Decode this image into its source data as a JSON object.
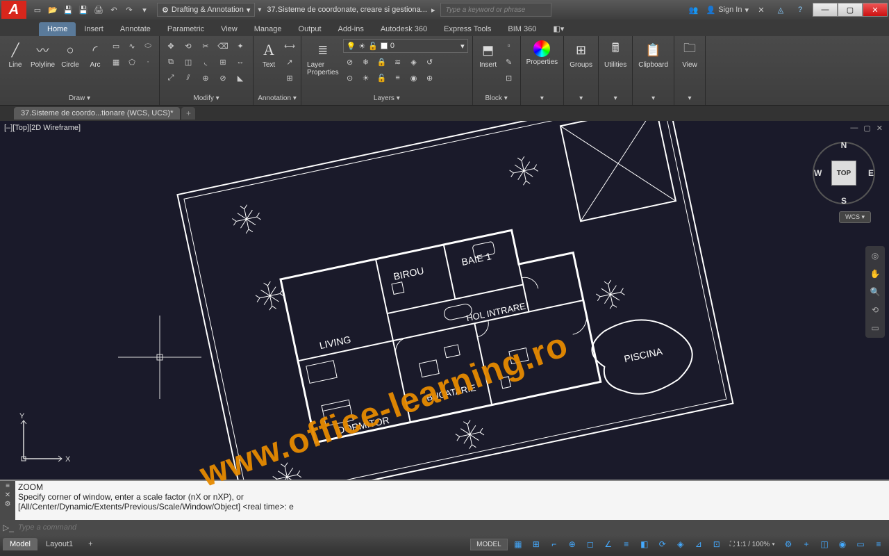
{
  "titlebar": {
    "workspace": "Drafting & Annotation",
    "document_title": "37.Sisteme de coordonate, creare si gestiona...",
    "search_placeholder": "Type a keyword or phrase",
    "signin": "Sign In"
  },
  "ribbon": {
    "tabs": [
      "Home",
      "Insert",
      "Annotate",
      "Parametric",
      "View",
      "Manage",
      "Output",
      "Add-ins",
      "Autodesk 360",
      "Express Tools",
      "BIM 360"
    ],
    "active_tab": "Home",
    "panels": {
      "draw": {
        "label": "Draw ▾",
        "line": "Line",
        "polyline": "Polyline",
        "circle": "Circle",
        "arc": "Arc"
      },
      "modify": {
        "label": "Modify ▾"
      },
      "annotation": {
        "label": "Annotation ▾",
        "text": "Text"
      },
      "layers": {
        "label": "Layers ▾",
        "props": "Layer\nProperties",
        "current": "0"
      },
      "block": {
        "label": "Block ▾",
        "insert": "Insert"
      },
      "properties": {
        "label": "Properties"
      },
      "groups": {
        "label": "Groups"
      },
      "utilities": {
        "label": "Utilities"
      },
      "clipboard": {
        "label": "Clipboard"
      },
      "view": {
        "label": "View"
      }
    }
  },
  "file_tab": "37.Sisteme de coordo...tionare (WCS, UCS)*",
  "viewport": {
    "label": "[–][Top][2D Wireframe]",
    "viewcube_face": "TOP",
    "wcs": "WCS",
    "ucs_x": "X",
    "ucs_y": "Y",
    "compass": {
      "n": "N",
      "s": "S",
      "e": "E",
      "w": "W"
    }
  },
  "rooms": {
    "birou": "BIROU",
    "baie1": "BAIE 1",
    "living": "LIVING",
    "hol": "HOL INTRARE",
    "dormitor": "DORMITOR",
    "bucatarie": "BUCATARIE",
    "piscina": "PISCINA"
  },
  "watermark": "www.office-learning.ro",
  "commandline": {
    "l1": "ZOOM",
    "l2": "Specify corner of window, enter a scale factor (nX or nXP), or",
    "l3": "[All/Center/Dynamic/Extents/Previous/Scale/Window/Object] <real time>: e",
    "placeholder": "Type a command"
  },
  "statusbar": {
    "model": "Model",
    "layout": "Layout1",
    "model_btn": "MODEL",
    "scale": "1:1 / 100%"
  }
}
